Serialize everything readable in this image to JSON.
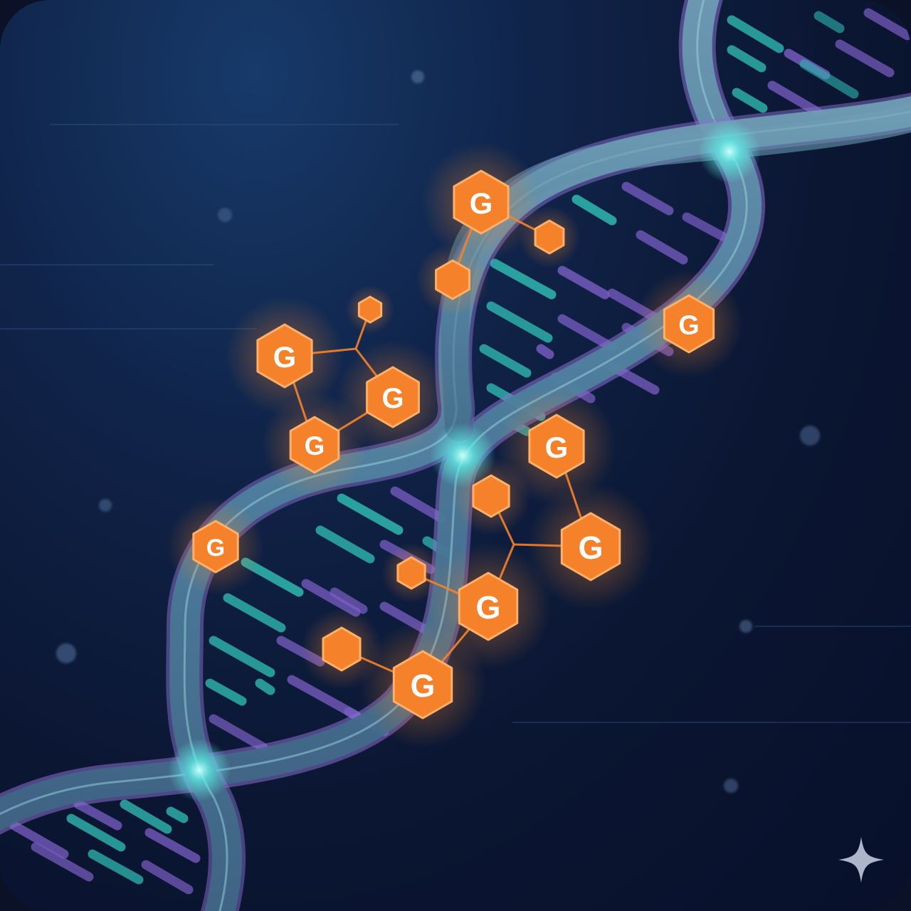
{
  "illustration": {
    "subject": "DNA double helix with guanine nodes",
    "node_letter": "G",
    "sparkle_icon": "sparkle-icon",
    "colors": {
      "background_top": "#173a6a",
      "background_bottom": "#08102a",
      "backbone": "#4f7f98",
      "backbone_highlight": "#9ad6e0",
      "backbone_purple": "#8a6fd0",
      "rung_teal": "#2fb7b0",
      "rung_purple": "#7a5fc4",
      "node_orange": "#f5822a",
      "node_stroke": "#ffb06a",
      "glow_cyan": "#5ff5ea"
    }
  }
}
